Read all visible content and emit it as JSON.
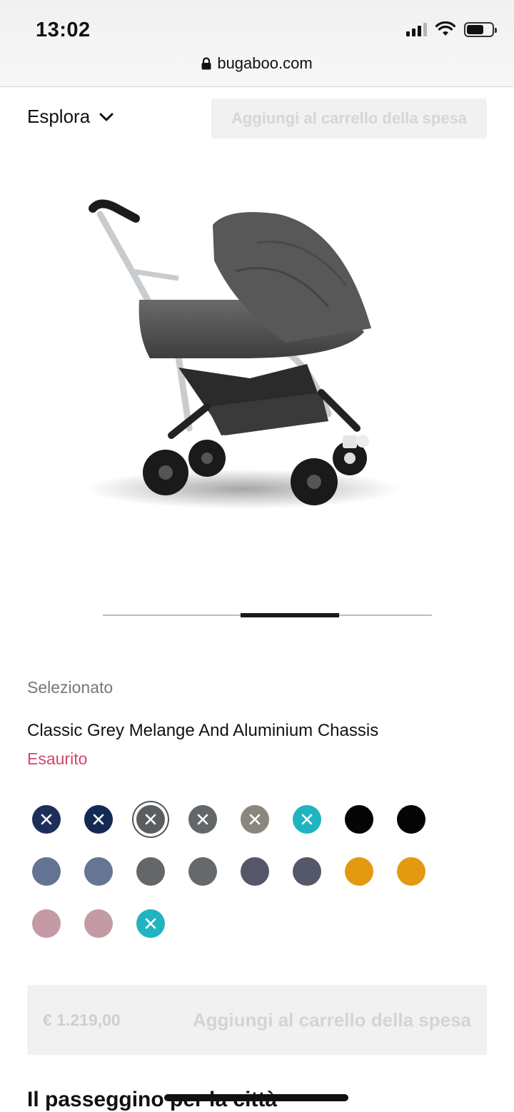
{
  "status_bar": {
    "time": "13:02"
  },
  "browser": {
    "url": "bugaboo.com"
  },
  "header": {
    "explore_label": "Esplora",
    "cart_button_label": "Aggiungi al carrello della spesa"
  },
  "product": {
    "image_alt": "Bugaboo Bee 5 stroller",
    "carousel": {
      "active_index": 2,
      "total": 3
    },
    "selected_label": "Selezionato",
    "variant_name": "Classic Grey Melange And Aluminium Chassis",
    "stock_status": "Esaurito",
    "price": "€ 1.219,00",
    "cart_button_label": "Aggiungi al carrello della spesa"
  },
  "swatches": [
    {
      "color": "#1b2f5a",
      "unavailable": true,
      "selected": false
    },
    {
      "color": "#142a55",
      "unavailable": true,
      "selected": false
    },
    {
      "color": "#5b5e61",
      "unavailable": true,
      "selected": true
    },
    {
      "color": "#646769",
      "unavailable": true,
      "selected": false
    },
    {
      "color": "#8b877e",
      "unavailable": true,
      "selected": false
    },
    {
      "color": "#1fb4c0",
      "unavailable": true,
      "selected": false
    },
    {
      "color": "#050505",
      "unavailable": false,
      "selected": false
    },
    {
      "color": "#050505",
      "unavailable": false,
      "selected": false
    },
    {
      "color": "#647393",
      "unavailable": false,
      "selected": false
    },
    {
      "color": "#667594",
      "unavailable": false,
      "selected": false
    },
    {
      "color": "#63676a",
      "unavailable": false,
      "selected": false
    },
    {
      "color": "#66696c",
      "unavailable": false,
      "selected": false
    },
    {
      "color": "#555768",
      "unavailable": false,
      "selected": false
    },
    {
      "color": "#555868",
      "unavailable": false,
      "selected": false
    },
    {
      "color": "#e49a10",
      "unavailable": false,
      "selected": false
    },
    {
      "color": "#e49a10",
      "unavailable": false,
      "selected": false
    },
    {
      "color": "#c49aa4",
      "unavailable": false,
      "selected": false
    },
    {
      "color": "#c49aa4",
      "unavailable": false,
      "selected": false
    },
    {
      "color": "#1fb4c0",
      "unavailable": true,
      "selected": false
    }
  ],
  "section": {
    "heading": "Il passeggino per la città"
  }
}
